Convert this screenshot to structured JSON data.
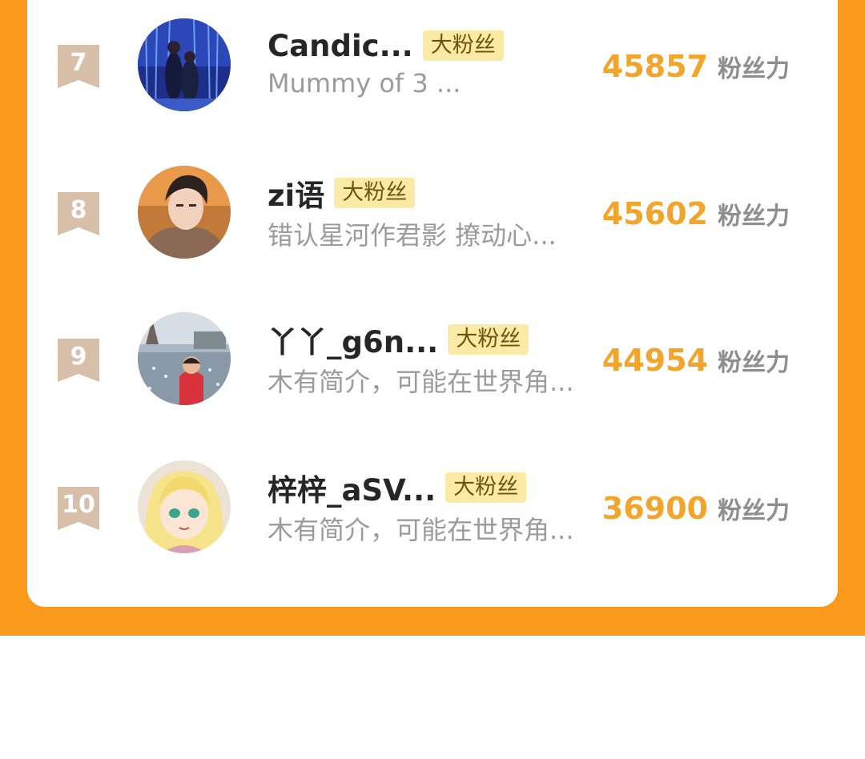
{
  "colors": {
    "accent_orange": "#f99a1c",
    "score_orange": "#f3a42a",
    "tag_bg": "#fbeaa6",
    "rank_badge": "#d8bfa9"
  },
  "rows": [
    {
      "rank": "7",
      "name": "Candic...",
      "tag": "大粉丝",
      "bio": "Mummy of 3 ...",
      "score": "45857",
      "score_unit": "粉丝力"
    },
    {
      "rank": "8",
      "name": "zi语",
      "tag": "大粉丝",
      "bio": "错认星河作君影 撩动心...",
      "score": "45602",
      "score_unit": "粉丝力"
    },
    {
      "rank": "9",
      "name": "丫丫_g6n...",
      "tag": "大粉丝",
      "bio": "木有简介，可能在世界角...",
      "score": "44954",
      "score_unit": "粉丝力"
    },
    {
      "rank": "10",
      "name": "梓梓_aSV...",
      "tag": "大粉丝",
      "bio": "木有简介，可能在世界角...",
      "score": "36900",
      "score_unit": "粉丝力"
    }
  ]
}
